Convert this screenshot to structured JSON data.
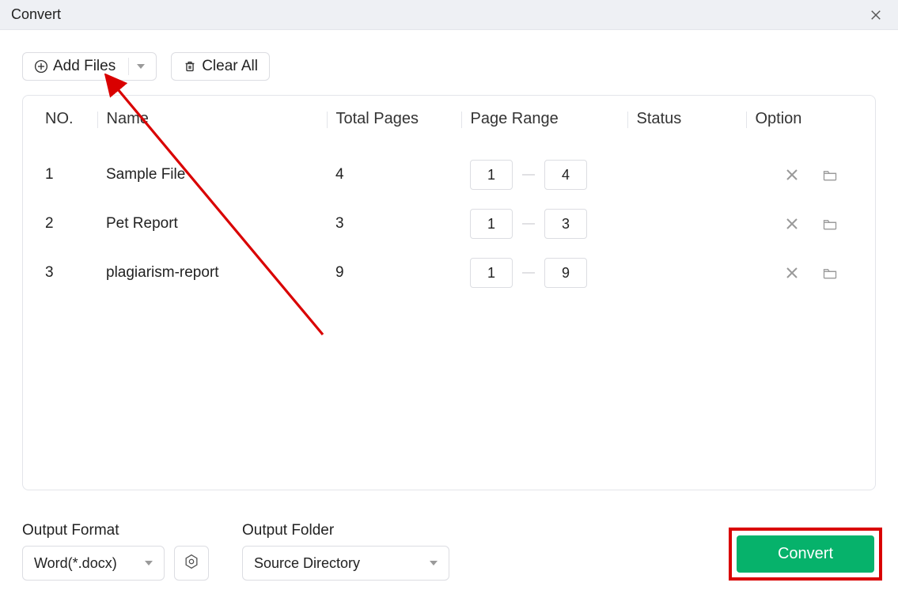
{
  "window": {
    "title": "Convert"
  },
  "toolbar": {
    "add_files_label": "Add Files",
    "clear_all_label": "Clear All"
  },
  "table": {
    "headers": {
      "no": "NO.",
      "name": "Name",
      "total_pages": "Total Pages",
      "page_range": "Page Range",
      "status": "Status",
      "option": "Option"
    },
    "rows": [
      {
        "no": "1",
        "name": "Sample File",
        "total_pages": "4",
        "range_from": "1",
        "range_to": "4",
        "status": ""
      },
      {
        "no": "2",
        "name": "Pet Report",
        "total_pages": "3",
        "range_from": "1",
        "range_to": "3",
        "status": ""
      },
      {
        "no": "3",
        "name": "plagiarism-report",
        "total_pages": "9",
        "range_from": "1",
        "range_to": "9",
        "status": ""
      }
    ]
  },
  "output_format": {
    "label": "Output Format",
    "value": "Word(*.docx)"
  },
  "output_folder": {
    "label": "Output Folder",
    "value": "Source Directory"
  },
  "convert_button_label": "Convert"
}
